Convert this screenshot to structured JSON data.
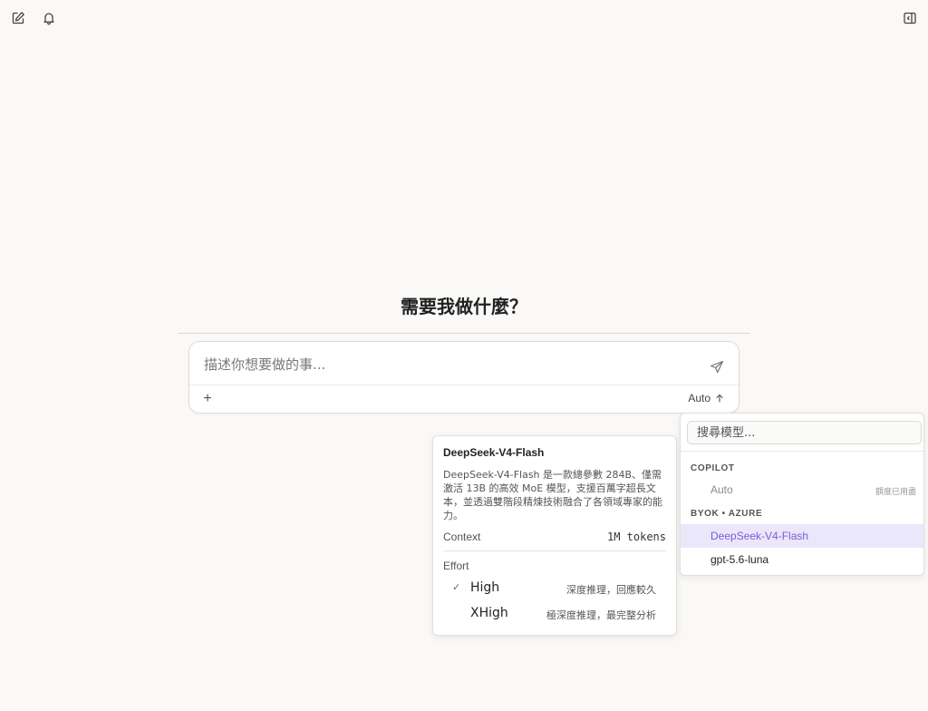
{
  "toolbar": {
    "new_chat_icon": "compose-icon",
    "notifications_icon": "bell-icon",
    "sidebar_toggle_icon": "sidebar-toggle-icon"
  },
  "main": {
    "heading": "需要我做什麼？"
  },
  "composer": {
    "placeholder": "描述你想要做的事...",
    "add_label": "+",
    "model_label": "Auto"
  },
  "model_info": {
    "name": "DeepSeek-V4-Flash",
    "description": "DeepSeek-V4-Flash 是一款總參數 284B、僅需激活 13B 的高效 MoE 模型，支援百萬字超長文本，並透過雙階段精煉技術融合了各領域專家的能力。",
    "context_label": "Context",
    "context_value": "1M tokens",
    "effort_label": "Effort",
    "efforts": [
      {
        "name": "High",
        "desc": "深度推理，回應較久",
        "selected": true,
        "check": "✓"
      },
      {
        "name": "XHigh",
        "desc": "極深度推理，最完整分析",
        "selected": false,
        "check": ""
      }
    ]
  },
  "model_menu": {
    "search_placeholder": "搜尋模型...",
    "groups": [
      {
        "label": "COPILOT",
        "items": [
          {
            "name": "Auto",
            "note": "額度已用盡",
            "disabled": true
          }
        ]
      },
      {
        "label": "BYOK • AZURE",
        "items": [
          {
            "name": "DeepSeek-V4-Flash",
            "selected": true
          },
          {
            "name": "gpt-5.6-luna"
          }
        ]
      }
    ]
  },
  "colors": {
    "background": "#faf9f7",
    "accent": "#7c5bd6",
    "selected_bg": "#ebe7fa"
  }
}
